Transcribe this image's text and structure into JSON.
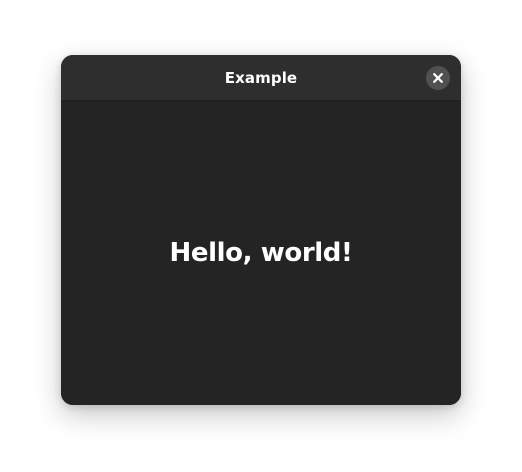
{
  "window": {
    "title": "Example"
  },
  "titlebar": {
    "close_icon": "close-icon"
  },
  "content": {
    "message": "Hello, world!"
  },
  "colors": {
    "page_background": "#ffffff",
    "window_background": "#242424",
    "titlebar_background": "#2e2e2e",
    "close_button_background": "#505050",
    "text": "#ffffff"
  }
}
